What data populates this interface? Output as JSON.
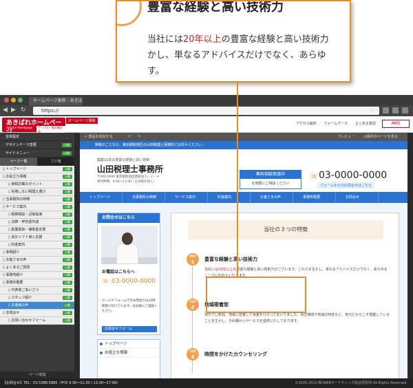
{
  "zoom": {
    "title": "豊富な経験と高い技術力",
    "line1_pre": "当社には",
    "line1_red": "20年以上",
    "line1_post": "の豊富な経験と高い技術力",
    "line2": "かし、単なるアドバイスだけでなく、あらゆ",
    "line3": "す。"
  },
  "browser": {
    "tab_title": "ホームページ更新 - あきば...",
    "url": "https://",
    "protocol_label": "https"
  },
  "app": {
    "logo_title": "あきばれホームページ",
    "logo_sub": "Akibare Homepage",
    "logo_badge": "サンプル一般の株記表",
    "update_tag": "ホームページ更新",
    "header_links": [
      "アクセス解析",
      "フォームデータ",
      "よくある質問"
    ],
    "ams": "AMS"
  },
  "sidebar": {
    "sections": [
      {
        "label": "全体設定"
      },
      {
        "label": "デザインテーマ変更",
        "status": "公開"
      },
      {
        "label": "サイドメニュー",
        "status": "公開"
      }
    ],
    "tabs": [
      "ページ一覧",
      "ゴミ箱"
    ],
    "pages": [
      {
        "label": "トップページ",
        "indent": 0,
        "status": "公開"
      },
      {
        "label": "お役立ち情報",
        "indent": 0,
        "status": "公開"
      },
      {
        "label": "節税対策のポイント",
        "indent": 1,
        "status": "公開"
      },
      {
        "label": "失敗しない税理士選び",
        "indent": 1,
        "status": "公開"
      },
      {
        "label": "当事務所の特徴",
        "indent": 0,
        "status": "公開"
      },
      {
        "label": "サービス案内",
        "indent": 0,
        "status": "公開"
      },
      {
        "label": "税務相談・記帳指導",
        "indent": 1,
        "status": "公開"
      },
      {
        "label": "決算・申告書作成",
        "indent": 1,
        "status": "公開"
      },
      {
        "label": "創業融資・補助金支援",
        "indent": 1,
        "status": "公開"
      },
      {
        "label": "会計ソフト導入支援",
        "indent": 1,
        "status": "公開"
      },
      {
        "label": "料金案内",
        "indent": 1,
        "status": "公開"
      },
      {
        "label": "事例紹介",
        "indent": 0,
        "status": "公開"
      },
      {
        "label": "お客さまの声",
        "indent": 0,
        "status": "公開"
      },
      {
        "label": "よくあるご質問",
        "indent": 0,
        "status": "公開"
      },
      {
        "label": "事務所紹介",
        "indent": 0,
        "status": "公開"
      },
      {
        "label": "事務所概要",
        "indent": 0,
        "status": "公開"
      },
      {
        "label": "代表者ごあいさつ",
        "indent": 1,
        "status": "公開"
      },
      {
        "label": "スタッフ紹介",
        "indent": 1,
        "status": "公開"
      },
      {
        "label": "お客様の声",
        "indent": 1,
        "status": "公開",
        "selected": true
      },
      {
        "label": "お問合せ",
        "indent": 0,
        "status": "公開"
      },
      {
        "label": "お問い合わせフォーム",
        "indent": 1,
        "status": "公開"
      }
    ],
    "footer": "ページ追加"
  },
  "toolbar": {
    "add_label": "部品を追加する",
    "preview_label": "プレビュー",
    "publish_label": "公開中のページを見る"
  },
  "site": {
    "notice": "節税のことなら、東京都新宿区の山田税理士事務所にお任せください。",
    "tagline": "開業10年の豊富な経験と高い技術",
    "firm": "山田税理士事務所",
    "addr1": "〒000-0000 東京都新宿区西新宿３－２－４",
    "addr2": "受付時間：9:00～17:00（土日祝を除く）",
    "consult_title": "無料相談実施中",
    "consult_sub": "お気軽にご相談ください",
    "phone": "03-0000-0000",
    "form_link": "フォームからのお問合せはこちら",
    "nav": [
      "トップページ",
      "当事務所の特徴",
      "サービス案内",
      "料金案内",
      "お客さまの声",
      "事務所概要",
      "お問合せ"
    ],
    "contact_box_title": "お問合せはこちら",
    "phone_label": "お電話はこちらへ",
    "box_phone": "03-0000-0000",
    "contact_desc": "メールやフォームでのお問合せは24時間受け付けています。お気軽にご連絡ください。",
    "form_btn": "お問合せフォーム",
    "left_nav": [
      "トップページ",
      "お役立ち情報"
    ],
    "main_title": "当社の３つの特徴",
    "features": [
      {
        "num": "1",
        "title": "豊富な経験と高い技術力",
        "desc_pre": "当社には",
        "desc_red": "20年以上",
        "desc_post": "の豊富な経験と高い技術力がございます。これらを生かし、単なるアドバイスだけでなく、あらゆるニーズにお応えいたします。"
      },
      {
        "num": "2",
        "title": "地域密着型",
        "desc": "地元で〇年間、地域に密着して事業を行なってまいりました。周辺環境や地域の特性など、地元だからこそ把握していることを生かし、きめ細かいサービスを提供いたしております。"
      },
      {
        "num": "3",
        "title": "時間をかけたカウンセリング",
        "desc": ""
      }
    ],
    "badge_word": "特徴"
  },
  "status": {
    "left": "【お問合せ】TEL：03-5388-5985（平日 9:30～11:30 / 13:30～17:00）",
    "right": "©2005-2013 株)WEBマーケティング総合研究所 All Rights Reserved."
  },
  "colors": {
    "accent": "#2b73d2",
    "brand": "#c8001e",
    "callout": "#e0902e",
    "highlight_text": "#dd2222",
    "published": "#3aa53a"
  }
}
